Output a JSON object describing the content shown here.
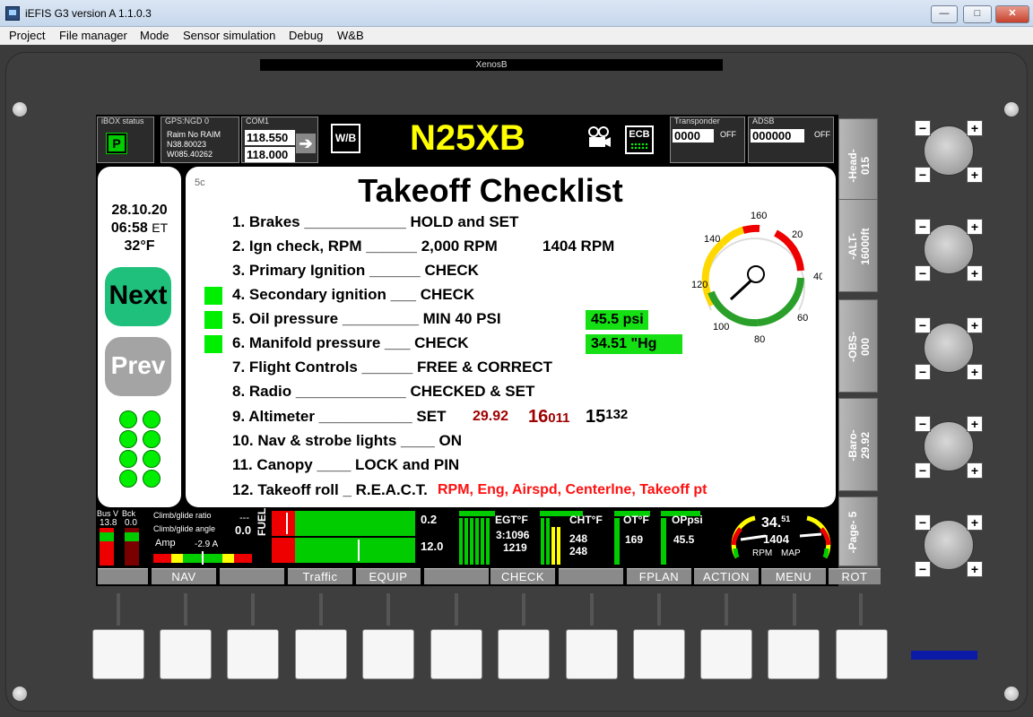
{
  "window": {
    "title": "iEFIS G3 version A 1.1.0.3",
    "minimize": "—",
    "maximize": "□",
    "close": "✕"
  },
  "menu": [
    "Project",
    "File manager",
    "Mode",
    "Sensor simulation",
    "Debug",
    "W&B"
  ],
  "device_name": "XenosB",
  "header": {
    "ibox_label": "iBOX status",
    "ibox_value": "P",
    "gps_label": "GPS:NGD 0",
    "gps_raim": "Raim   No RAIM",
    "gps_lat": "N38.80023",
    "gps_lon": "W085.40262",
    "com_label": "COM1",
    "com_active": "118.550",
    "com_standby": "118.000",
    "swap_arrow": "➔",
    "wb_label": "W/B",
    "tail_number": "N25XB",
    "camera_icon": "camera-icon",
    "ecb_label": "ECB",
    "transponder_label": "Transponder",
    "transponder_code": "0000",
    "transponder_state": "OFF",
    "adsb_label": "ADSB",
    "adsb_code": "000000",
    "adsb_state": "OFF"
  },
  "left": {
    "date": "28.10.20",
    "time": "06:58",
    "time_suffix": "ET",
    "temp": "32°F",
    "next": "Next",
    "prev": "Prev"
  },
  "checklist": {
    "page_id": "5c",
    "title": "Takeoff Checklist",
    "items": [
      "1. Brakes ____________ HOLD and SET",
      "2. Ign check, RPM ______ 2,000 RPM",
      "3. Primary Ignition ______ CHECK",
      "4. Secondary ignition ___ CHECK",
      "5. Oil pressure _________ MIN 40 PSI",
      "6. Manifold pressure ___  CHECK",
      "7. Flight Controls ______ FREE & CORRECT",
      "8. Radio _____________ CHECKED & SET",
      "9. Altimeter ___________  SET",
      "10. Nav & strobe lights ____ ON",
      "11. Canopy ____ LOCK and PIN",
      "12. Takeoff roll _ R.E.A.C.T."
    ],
    "rpm_value": "1404  RPM",
    "oil_value": "45.5 psi",
    "map_value": "34.51  \"Hg",
    "baro_value": "29.92",
    "alt_big": "16",
    "alt_small": "011",
    "alt2_big": "15",
    "alt2_small": "132",
    "react_text": "RPM, Eng, Airspd, Centerlne, Takeoff pt",
    "gauge_labels": [
      "160",
      "20",
      "140",
      "40",
      "120",
      "60",
      "100",
      "80"
    ]
  },
  "engine": {
    "bus_label": "Bus V",
    "bck_label": "Bck",
    "bus_value": "13.8",
    "bck_value": "0.0",
    "cr_label": "Climb/glide ratio",
    "cr_value": "---",
    "ca_label": "Climb/glide angle",
    "ca_value": "0.0",
    "amp_label": "Amp",
    "amp_value": "-2.9 A",
    "fuel_label": "FUEL",
    "fuel_top": "0.2",
    "fuel_bottom": "12.0",
    "egt_label": "EGT°F",
    "egt_line1": "3:1096",
    "egt_line2": "1219",
    "cht_label": "CHT°F",
    "cht_line1": "248",
    "cht_line2": "248",
    "ot_label": "OT°F",
    "ot_value": "169",
    "op_label": "OPpsi",
    "op_value": "45.5",
    "rpm_big": "34.",
    "rpm_sup": "51",
    "rpm_mid": "1404",
    "rpm_label": "RPM",
    "map_label": "MAP"
  },
  "softkeys": [
    "",
    "NAV",
    "",
    "Traffic",
    "EQUIP",
    "",
    "CHECK",
    "",
    "FPLAN",
    "ACTION",
    "MENU",
    "ROT"
  ],
  "right_buttons": [
    {
      "name": "Head",
      "value": "015"
    },
    {
      "name": "ALT",
      "value": "16000ft"
    },
    {
      "name": "OBS",
      "value": "000"
    },
    {
      "name": "Baro",
      "value": "29.92"
    },
    {
      "name": "Page",
      "value": "5"
    }
  ],
  "right_button_labels": [
    "-Head-\n015",
    "-ALT-\n16000ft",
    "-OBS-\n000",
    "-Baro-\n29.92",
    "-Page-\n5"
  ],
  "knob_minus": "−",
  "knob_plus": "+"
}
